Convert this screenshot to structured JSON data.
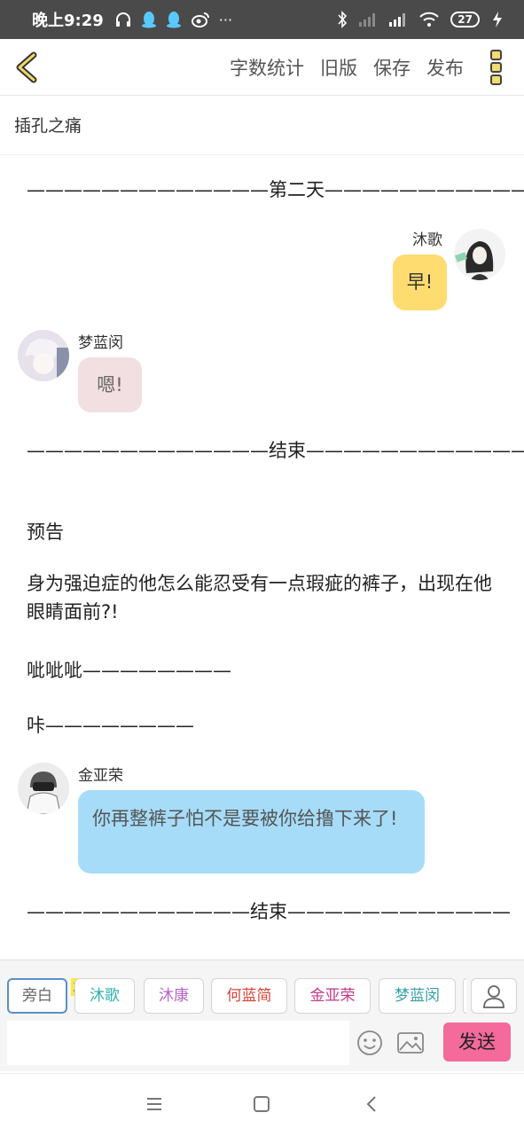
{
  "status_bar": {
    "time": "晚上9:29",
    "dots": "···",
    "battery": "27"
  },
  "toolbar": {
    "word_count": "字数统计",
    "old_version": "旧版",
    "save": "保存",
    "publish": "发布"
  },
  "doc_title": "插孔之痛",
  "content": {
    "divider_day2": "—————————————第二天————————————",
    "msg1": {
      "name": "沐歌",
      "text": "早!"
    },
    "msg2": {
      "name": "梦蓝闵",
      "text": "嗯!"
    },
    "divider_end1": "—————————————结束—————————————",
    "preview_label": "预告",
    "preview_para": "身为强迫症的他怎么能忍受有一点瑕疵的裤子，出现在他眼睛面前?!",
    "sound1": "呲呲呲————————",
    "sound2": "咔————————",
    "msg3": {
      "name": "金亚荣",
      "text": "你再整裤子怕不是要被你给撸下来了!"
    },
    "divider_end2": "————————————结束————————————"
  },
  "characters": {
    "narrator": "旁白",
    "main_badge": "主",
    "c1": "沐歌",
    "c2": "沐康",
    "c3": "何蓝简",
    "c4": "金亚荣",
    "c5": "梦蓝闵"
  },
  "input": {
    "placeholder": "",
    "send": "发送"
  },
  "colors": {
    "bubble_yellow": "#fedc6f",
    "bubble_pink": "#f2dfe1",
    "bubble_blue": "#a6dcf8",
    "send_button": "#f46a9a",
    "chip_c1": "#32b2ae",
    "chip_c2": "#b565c7",
    "chip_c3": "#d9453a",
    "chip_c4": "#c03c8a",
    "chip_c5": "#3aa0a8"
  }
}
